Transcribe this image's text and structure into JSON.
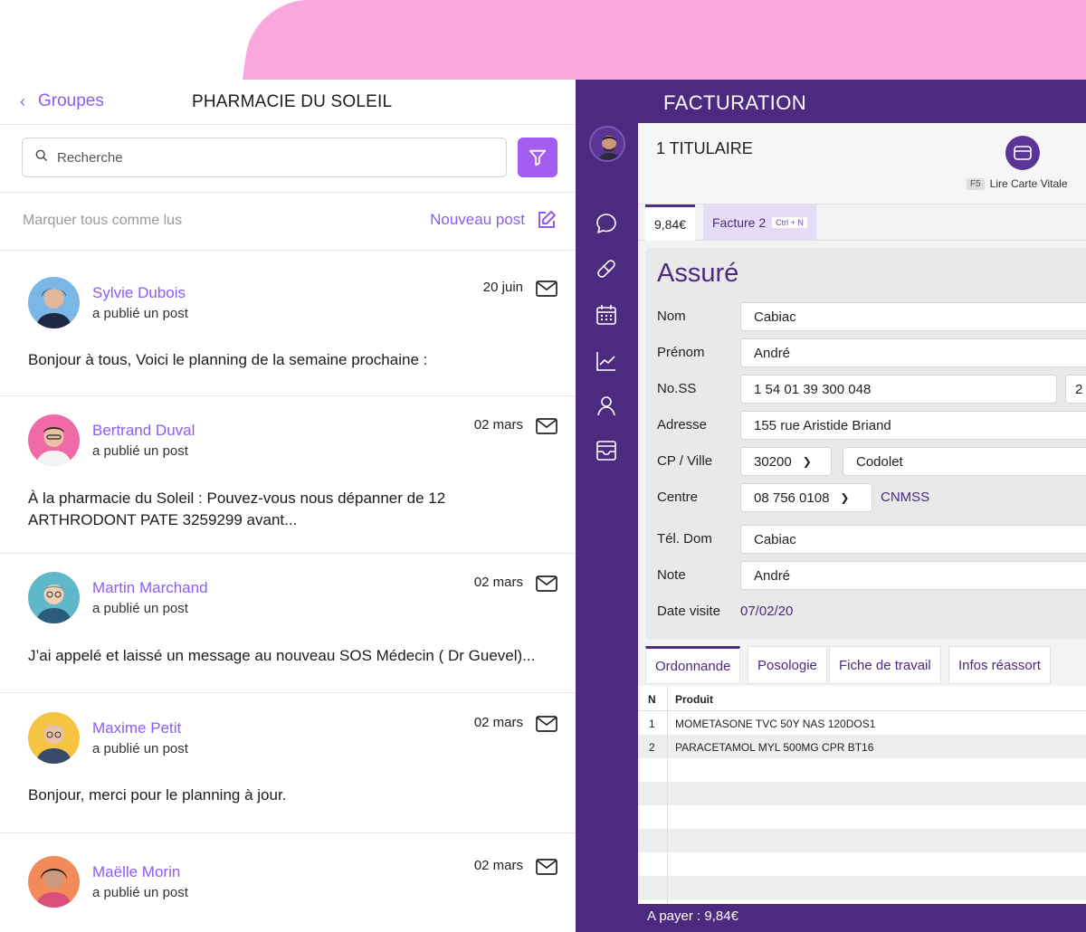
{
  "left_panel": {
    "back_label": "Groupes",
    "title": "PHARMACIE DU SOLEIL",
    "search_placeholder": "Recherche",
    "mark_all_read": "Marquer tous comme lus",
    "new_post": "Nouveau post",
    "posts": [
      {
        "author": "Sylvie Dubois",
        "action": "a publié un post",
        "date": "20 juin",
        "text": "Bonjour à tous, Voici le planning de la semaine prochaine :",
        "avatar_bg": "#7ab6e6"
      },
      {
        "author": "Bertrand Duval",
        "action": "a publié un post",
        "date": "02 mars",
        "text": "À la pharmacie du Soleil : Pouvez-vous nous dépanner de 12 ARTHRODONT PATE 3259299 avant...",
        "avatar_bg": "#f06aa8"
      },
      {
        "author": "Martin Marchand",
        "action": "a publié un post",
        "date": "02 mars",
        "text": "J’ai appelé et laissé un message au nouveau SOS Médecin ( Dr Guevel)...",
        "avatar_bg": "#5fb8c9"
      },
      {
        "author": "Maxime Petit",
        "action": "a publié un post",
        "date": "02 mars",
        "text": "Bonjour, merci pour le planning à jour.",
        "avatar_bg": "#f5c542"
      },
      {
        "author": "Maëlle Morin",
        "action": "a publié un post",
        "date": "02 mars",
        "text": "",
        "avatar_bg": "#f28a5a"
      }
    ]
  },
  "right_panel": {
    "title": "FACTURATION",
    "titulaire": "1 TITULAIRE",
    "carte_vitale_key": "F5",
    "carte_vitale_label": "Lire Carte Vitale",
    "invoice_amount_tab": "9,84€",
    "invoice_tab": "Facture 2",
    "invoice_tab_shortcut": "Ctrl + N",
    "assure": {
      "title": "Assuré",
      "nom_label": "Nom",
      "nom": "Cabiac",
      "prenom_label": "Prénom",
      "prenom": "André",
      "noss_label": "No.SS",
      "noss": "1 54 01 39 300 048",
      "noss_key": "2",
      "adresse_label": "Adresse",
      "adresse": "155 rue Aristide Briand",
      "cpville_label": "CP / Ville",
      "cp": "30200",
      "ville": "Codolet",
      "centre_label": "Centre",
      "centre": "08 756 0108",
      "centre_org": "CNMSS",
      "tel_label": "Tél. Dom",
      "tel": "Cabiac",
      "note_label": "Note",
      "note": "André",
      "date_label": "Date visite",
      "date": "07/02/20"
    },
    "tabs": [
      "Ordonnande",
      "Posologie",
      "Fiche de travail",
      "Infos réassort"
    ],
    "table": {
      "headers": {
        "n": "N",
        "produit": "Produit"
      },
      "rows": [
        {
          "n": "1",
          "produit": "MOMETASONE TVC 50Y NAS 120DOS1"
        },
        {
          "n": "2",
          "produit": "PARACETAMOL MYL 500MG CPR BT16"
        }
      ]
    },
    "footer": "A payer : 9,84€"
  },
  "colors": {
    "accent": "#8b5cf6",
    "sidebar": "#4b2a7f",
    "pink": "#f8a8dc"
  },
  "icons": [
    "chevron-left-icon",
    "search-icon",
    "filter-icon",
    "edit-icon",
    "mail-icon",
    "chat-icon",
    "pill-icon",
    "calendar-icon",
    "chart-icon",
    "user-icon",
    "inbox-icon",
    "card-icon"
  ]
}
